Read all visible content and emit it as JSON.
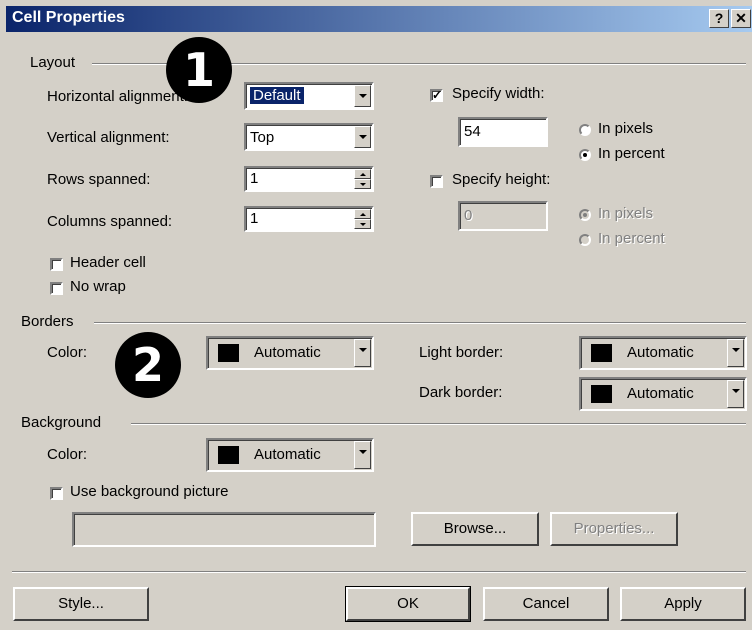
{
  "title": "Cell Properties",
  "title_buttons": {
    "help": "?",
    "close": "✕"
  },
  "layout": {
    "section": "Layout",
    "horizontal_alignment": {
      "label": "Horizontal alignment:",
      "value": "Default"
    },
    "vertical_alignment": {
      "label": "Vertical alignment:",
      "value": "Top"
    },
    "rows_spanned": {
      "label": "Rows spanned:",
      "value": "1"
    },
    "columns_spanned": {
      "label": "Columns spanned:",
      "value": "1"
    },
    "header_cell": {
      "label": "Header cell",
      "checked": false
    },
    "no_wrap": {
      "label": "No wrap",
      "checked": false
    },
    "specify_width": {
      "label": "Specify width:",
      "checked": true,
      "value": "54"
    },
    "width_in_pixels": "In pixels",
    "width_in_percent": "In percent",
    "specify_height": {
      "label": "Specify height:",
      "checked": false,
      "value": "0"
    },
    "height_in_pixels": "In pixels",
    "height_in_percent": "In percent"
  },
  "borders": {
    "section": "Borders",
    "color": {
      "label": "Color:",
      "value": "Automatic"
    },
    "light_border": {
      "label": "Light border:",
      "value": "Automatic"
    },
    "dark_border": {
      "label": "Dark border:",
      "value": "Automatic"
    }
  },
  "background": {
    "section": "Background",
    "color": {
      "label": "Color:",
      "value": "Automatic"
    },
    "use_picture": {
      "label": "Use background picture",
      "checked": false
    },
    "picture_path": "",
    "browse_label": "Browse...",
    "properties_label": "Properties..."
  },
  "buttons": {
    "style": "Style...",
    "ok": "OK",
    "cancel": "Cancel",
    "apply": "Apply"
  },
  "callouts": {
    "one": "1",
    "two": "2"
  },
  "colors": {
    "titlebar_start": "#0a246a",
    "titlebar_end": "#a6caf0",
    "face": "#d4d0c8"
  }
}
